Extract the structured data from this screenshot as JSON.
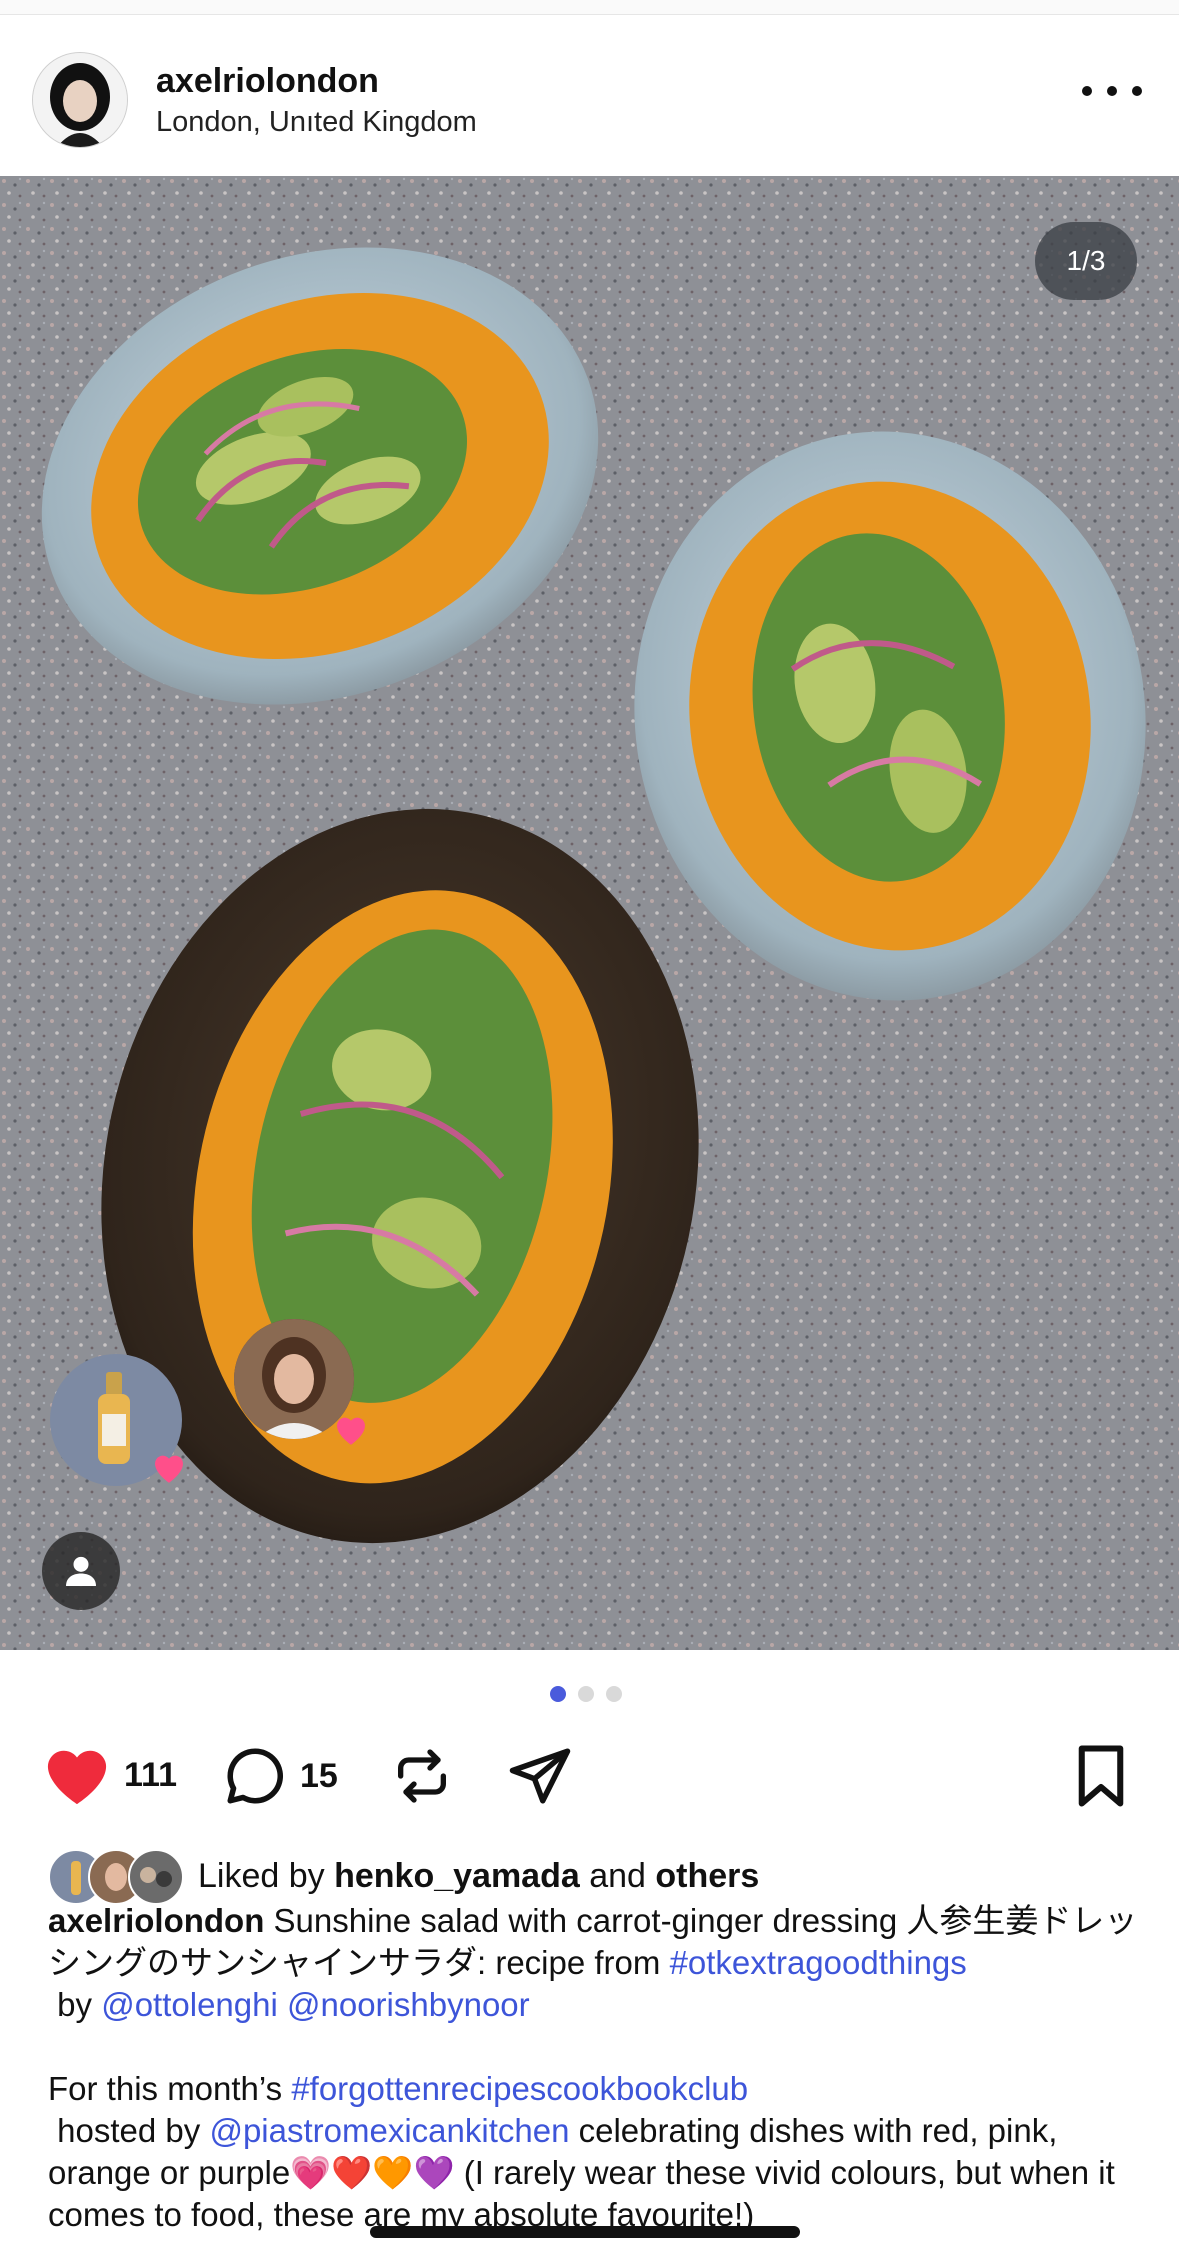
{
  "post": {
    "username": "axelriolondon",
    "location": "London, Unıted Kingdom",
    "image_counter": "1/3"
  },
  "carousel": {
    "count": 3,
    "active_index": 0
  },
  "actions": {
    "likes": "111",
    "comments": "15"
  },
  "liked_by": {
    "prefix": "Liked by ",
    "user": "henko_yamada",
    "middle": " and ",
    "others": "others"
  },
  "caption": {
    "username": "axelriolondon",
    "text1": " Sunshine salad with carrot-ginger dressing 人参生姜ドレッシングのサンシャインサラダ: recipe from ",
    "hashtag1": "#otkextragoodthings",
    "by": " by ",
    "mention1": "@ottolenghi",
    "space": " ",
    "mention2": "@noorishbynoor",
    "para2_start": "For this month’s ",
    "hashtag2": "#forgottenrecipescookbookclub",
    "hosted": " hosted by ",
    "mention3": "@piastromexicankitchen",
    "text2": " celebrating dishes with red, pink, orange or purple",
    "emojis": "💗❤️🧡💜",
    "text3": " (I rarely wear these vivid colours, but when it comes to food, these are my absolute favourite!)"
  },
  "colors": {
    "like_red": "#ef2b3c",
    "link_blue": "#3d55d9",
    "active_dot": "#4a5bdc"
  },
  "icons": [
    "more-icon",
    "heart-icon",
    "comment-icon",
    "repost-icon",
    "share-icon",
    "bookmark-icon",
    "user-tag-icon"
  ]
}
